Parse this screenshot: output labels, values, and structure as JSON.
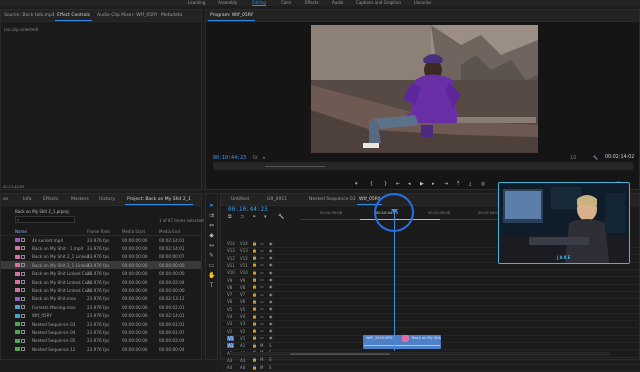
{
  "workspace": {
    "tabs": [
      "Learning",
      "Assembly",
      "Editing",
      "Color",
      "Effects",
      "Audio",
      "Captions and Graphics",
      "Libraries"
    ],
    "active": "Editing"
  },
  "source_panel": {
    "tabs": [
      "Source: Back talk.mp4",
      "Effect Controls",
      "Audio Clip Mixer: Wtf_05RY",
      "Metadata"
    ],
    "empty_text": "(no clip selected)",
    "timecode": "00:10:44:23"
  },
  "program_monitor": {
    "title": "Program: Wtf_05RY",
    "timecode": "00:10:44:23",
    "fit": "Fit",
    "quality": "1/2",
    "duration": "00:02:14:02"
  },
  "project_panel": {
    "tabs": [
      "es",
      "Info",
      "Effects",
      "Markers",
      "History",
      "Project: Back on My Shit 2_1"
    ],
    "path": "Back on My Shit 2_1.prproj",
    "selection_info": "1 of 87 items selected",
    "columns": [
      "Name",
      "Frame Rate",
      "Media Start",
      "Media End"
    ],
    "items": [
      {
        "name": "4k sunset.mp4",
        "rate": "23.976 fps",
        "start": "00:00:00:00",
        "end": "00:02:14:01",
        "color": "#9b5ec8"
      },
      {
        "name": "Back on My Shit - 1.mp4",
        "rate": "23.976 fps",
        "start": "00:00:00:00",
        "end": "00:02:14:01",
        "color": "#d86fa5"
      },
      {
        "name": "Back on My Shit 2_1 Linked",
        "rate": "23.976 fps",
        "start": "00:00:00:00",
        "end": "00:00:00:07",
        "color": "#d86fa5"
      },
      {
        "name": "Back on My Shit 2_1 Linked",
        "rate": "23.976 fps",
        "start": "00:00:00:00",
        "end": "00:00:00:00",
        "color": "#d86fa5"
      },
      {
        "name": "Back on My Shit Linked Com",
        "rate": "23.976 fps",
        "start": "00:00:00:00",
        "end": "00:00:00:00",
        "color": "#d86fa5"
      },
      {
        "name": "Back on My Shit Linked Com",
        "rate": "23.976 fps",
        "start": "00:00:00:00",
        "end": "00:00:02:04",
        "color": "#d86fa5"
      },
      {
        "name": "Back on My Shit Linked Com",
        "rate": "23.976 fps",
        "start": "00:00:00:00",
        "end": "00:00:00:00",
        "color": "#d86fa5"
      },
      {
        "name": "Back on My Shit.mov",
        "rate": "23.976 fps",
        "start": "00:00:00:00",
        "end": "00:02:13:12",
        "color": "#9b5ec8"
      },
      {
        "name": "Forrests Moving.mov",
        "rate": "23.976 fps",
        "start": "00:00:00:00",
        "end": "00:00:02:01",
        "color": "#4aa3d6"
      },
      {
        "name": "Wtf_05RY",
        "rate": "23.976 fps",
        "start": "00:00:00:00",
        "end": "00:02:14:01",
        "color": "#4aa3d6"
      },
      {
        "name": "Nested Sequence 03",
        "rate": "23.976 fps",
        "start": "00:00:00:00",
        "end": "00:00:01:01",
        "color": "#4fa85a"
      },
      {
        "name": "Nested Sequence 04",
        "rate": "23.976 fps",
        "start": "00:00:00:00",
        "end": "00:00:01:07",
        "color": "#4fa85a"
      },
      {
        "name": "Nested Sequence 05",
        "rate": "23.976 fps",
        "start": "00:00:00:00",
        "end": "00:00:02:04",
        "color": "#4fa85a"
      },
      {
        "name": "Nested Sequence 12",
        "rate": "23.976 fps",
        "start": "00:00:00:00",
        "end": "00:00:00:04",
        "color": "#4fa85a"
      }
    ]
  },
  "timeline": {
    "tabs": [
      "Untitled",
      "G9_0911",
      "Nested Sequence 03",
      "Wtf_05RY"
    ],
    "active_tab": "Wtf_05RY",
    "timecode": "00:10:44:23",
    "ruler": [
      "00:10:39:08",
      "00:10:44:23",
      "00:10:49:08",
      "00:10:54:08"
    ],
    "video_tracks": [
      "V14",
      "V13",
      "V12",
      "V11",
      "V10",
      "V9",
      "V8",
      "V7",
      "V6",
      "V5",
      "V4",
      "V3",
      "V2",
      "V1"
    ],
    "audio_tracks": [
      "A1",
      "A2",
      "A3",
      "A4"
    ],
    "clips": {
      "v1_a": "WtF_1029.MP4",
      "v1_b": "Back on My Shit"
    }
  },
  "webcam": {
    "label": "JAKE"
  },
  "status": {
    "left_timecode": "00:13:44:05"
  },
  "colors": {
    "accent": "#2d8ceb",
    "highlight_ring": "#2670e8",
    "clip_blue": "#4e7fc9",
    "clip_pink": "#d86fa5",
    "audio_clip": "#4e7fc9"
  }
}
